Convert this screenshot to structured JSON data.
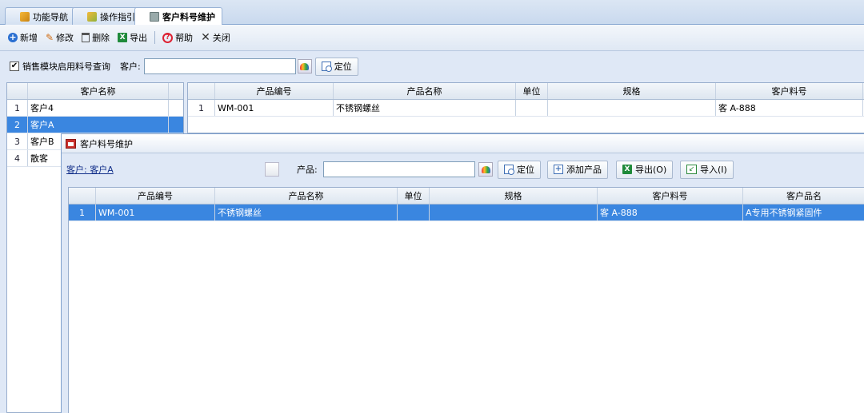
{
  "tabs": [
    {
      "label": "功能导航",
      "icon": "navigation-icon"
    },
    {
      "label": "操作指引",
      "icon": "guide-icon"
    },
    {
      "label": "客户料号维护",
      "icon": "printer-icon",
      "active": true
    }
  ],
  "toolbar": {
    "add": "新增",
    "edit": "修改",
    "delete": "删除",
    "export": "导出",
    "help": "帮助",
    "close": "关闭"
  },
  "filter": {
    "checkbox_label": "销售模块启用料号查询",
    "checked": true,
    "customer_label": "客户:",
    "customer_value": "",
    "locate": "定位"
  },
  "customer_grid": {
    "header": "客户名称",
    "rows": [
      {
        "n": "1",
        "name": "客户4"
      },
      {
        "n": "2",
        "name": "客户A"
      },
      {
        "n": "3",
        "name": "客户B"
      },
      {
        "n": "4",
        "name": "散客"
      }
    ],
    "selected_index": 1
  },
  "product_grid": {
    "headers": [
      "产品编号",
      "产品名称",
      "单位",
      "规格",
      "客户料号"
    ],
    "rows": [
      {
        "n": "1",
        "code": "WM-001",
        "name": "不锈钢螺丝",
        "unit": "",
        "spec": "",
        "cust_no": "客 A-888"
      }
    ]
  },
  "dialog": {
    "title": "客户料号维护",
    "customer_link": "客户: 客户A",
    "product_label": "产品:",
    "product_value": "",
    "locate": "定位",
    "add_product": "添加产品",
    "export": "导出(O)",
    "import": "导入(I)",
    "grid": {
      "headers": [
        "产品编号",
        "产品名称",
        "单位",
        "规格",
        "客户料号",
        "客户品名"
      ],
      "rows": [
        {
          "n": "1",
          "code": "WM-001",
          "name": "不锈钢螺丝",
          "unit": "",
          "spec": "",
          "cust_no": "客 A-888",
          "cust_name": "A专用不锈钢紧固件"
        }
      ]
    }
  },
  "colors": {
    "background": "#dfe8f6",
    "selection": "#3a86e0",
    "border": "#99aecd"
  }
}
